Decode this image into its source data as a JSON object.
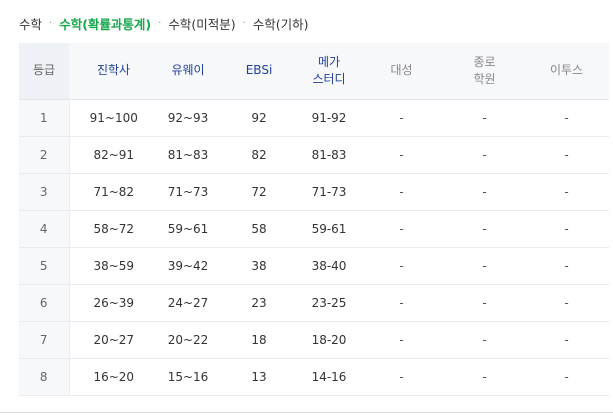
{
  "tabs": [
    {
      "label": "수학",
      "active": false
    },
    {
      "label": "수학(확률과통계)",
      "active": true
    },
    {
      "label": "수학(미적분)",
      "active": false
    },
    {
      "label": "수학(기하)",
      "active": false
    }
  ],
  "tab_separator": "·",
  "colors": {
    "active_tab": "#18a84e",
    "header_blue": "#1f3fa0",
    "header_gray": "#888888"
  },
  "table": {
    "headers": [
      {
        "label": "등급",
        "line2": "",
        "style": "grade"
      },
      {
        "label": "진학사",
        "line2": "",
        "style": "blue"
      },
      {
        "label": "유웨이",
        "line2": "",
        "style": "blue"
      },
      {
        "label": "EBSi",
        "line2": "",
        "style": "blue"
      },
      {
        "label": "메가",
        "line2": "스터디",
        "style": "blue"
      },
      {
        "label": "대성",
        "line2": "",
        "style": "gray"
      },
      {
        "label": "종로",
        "line2": "학원",
        "style": "gray"
      },
      {
        "label": "이투스",
        "line2": "",
        "style": "gray"
      }
    ],
    "rows": [
      [
        "1",
        "91~100",
        "92~93",
        "92",
        "91-92",
        "-",
        "-",
        "-"
      ],
      [
        "2",
        "82~91",
        "81~83",
        "82",
        "81-83",
        "-",
        "-",
        "-"
      ],
      [
        "3",
        "71~82",
        "71~73",
        "72",
        "71-73",
        "-",
        "-",
        "-"
      ],
      [
        "4",
        "58~72",
        "59~61",
        "58",
        "59-61",
        "-",
        "-",
        "-"
      ],
      [
        "5",
        "38~59",
        "39~42",
        "38",
        "38-40",
        "-",
        "-",
        "-"
      ],
      [
        "6",
        "26~39",
        "24~27",
        "23",
        "23-25",
        "-",
        "-",
        "-"
      ],
      [
        "7",
        "20~27",
        "20~22",
        "18",
        "18-20",
        "-",
        "-",
        "-"
      ],
      [
        "8",
        "16~20",
        "15~16",
        "13",
        "14-16",
        "-",
        "-",
        "-"
      ]
    ]
  }
}
